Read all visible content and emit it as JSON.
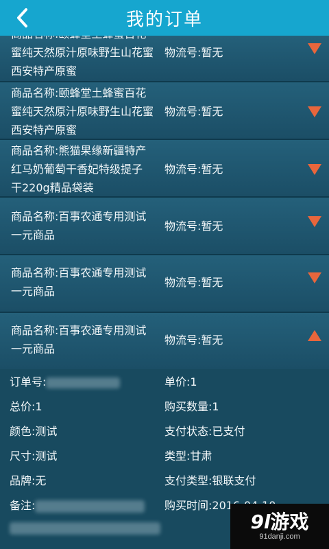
{
  "header": {
    "title": "我的订单",
    "back_icon": "chevron-left-icon"
  },
  "orders": [
    {
      "name_lines": [
        "商品名称:颐蜂堂土蜂蜜百花",
        "蜜纯天然原汁原味野生山花蜜",
        "西安特产原蜜"
      ],
      "logistics": "物流号:暂无",
      "expanded": false
    },
    {
      "name_lines": [
        "商品名称:颐蜂堂土蜂蜜百花",
        "蜜纯天然原汁原味野生山花蜜",
        "西安特产原蜜"
      ],
      "logistics": "物流号:暂无",
      "expanded": false
    },
    {
      "name_lines": [
        "商品名称:熊猫果缘新疆特产",
        "红马奶葡萄干香妃特级提子",
        "干220g精品袋装"
      ],
      "logistics": "物流号:暂无",
      "expanded": false
    },
    {
      "name_lines": [
        "商品名称:百事农通专用测试",
        "一元商品"
      ],
      "logistics": "物流号:暂无",
      "expanded": false
    },
    {
      "name_lines": [
        "商品名称:百事农通专用测试",
        "一元商品"
      ],
      "logistics": "物流号:暂无",
      "expanded": false
    },
    {
      "name_lines": [
        "商品名称:百事农通专用测试",
        "一元商品"
      ],
      "logistics": "物流号:暂无",
      "expanded": true
    }
  ],
  "details": {
    "order_no_label": "订单号:",
    "unit_price": "单价:1",
    "total_price": "总价:1",
    "quantity": "购买数量:1",
    "color": "颜色:测试",
    "pay_status": "支付状态:已支付",
    "size": "尺寸:测试",
    "type": "类型:甘肃",
    "brand": "品牌:无",
    "pay_type": "支付类型:银联支付",
    "remark_label": "备注:",
    "purchase_time": "购买时间:2016-04-10"
  },
  "watermark": {
    "logo_num": "9l",
    "logo_text": "游戏",
    "site": "91danji.com"
  },
  "colors": {
    "header": "#16a6cf",
    "arrow": "#e8663c",
    "background": "#1f5a72"
  }
}
